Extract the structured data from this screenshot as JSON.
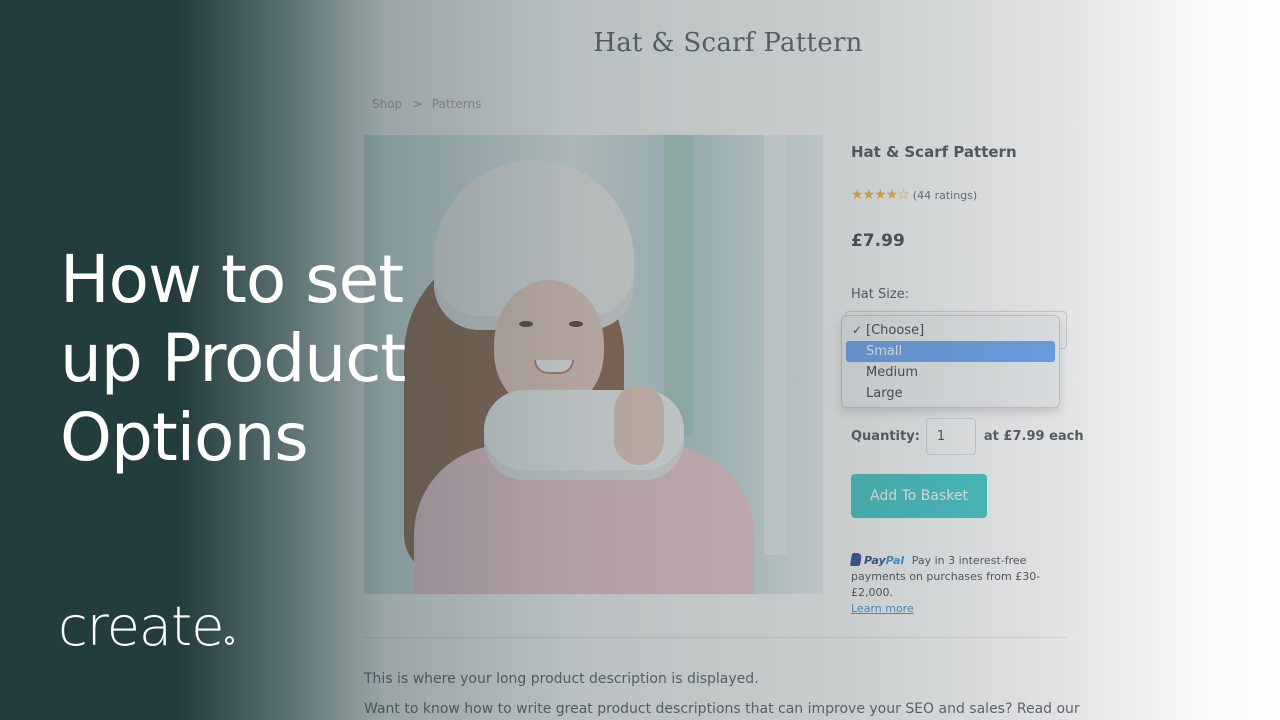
{
  "site": {
    "title": "Hat & Scarf Pattern"
  },
  "breadcrumb": {
    "items": [
      "Shop",
      "Patterns"
    ],
    "separator": ">"
  },
  "product": {
    "name": "Hat & Scarf Pattern",
    "rating": {
      "stars": 3.5,
      "max": 5,
      "count_text": "(44 ratings)"
    },
    "price": "£7.99",
    "option_label": "Hat Size:",
    "options": [
      "[Choose]",
      "Small",
      "Medium",
      "Large"
    ],
    "selected_option": "[Choose]",
    "highlighted_option": "Small",
    "quantity_label": "Quantity:",
    "quantity_value": "1",
    "unit_price_text": "at £7.99 each",
    "add_button_label": "Add To Basket"
  },
  "paypal": {
    "logo_pay": "Pay",
    "logo_pal": "Pal",
    "message": "Pay in 3 interest-free payments on purchases from £30-£2,000.",
    "link_text": "Learn more"
  },
  "description": {
    "line1": "This is where your long product description is displayed.",
    "line2": "Want to know how to write great product descriptions that can improve your SEO and sales? Read our"
  },
  "overlay": {
    "headline_lines": [
      "How to set",
      "up Product",
      "Options"
    ],
    "brand": "create"
  },
  "colors": {
    "overlay_dark": "#233c3e",
    "button": "#2ec4c4",
    "dropdown_highlight": "#5b9cf5",
    "stars": "#f0b323",
    "paypal_blue": "#1a3a8a",
    "paypal_light": "#2590d6"
  }
}
